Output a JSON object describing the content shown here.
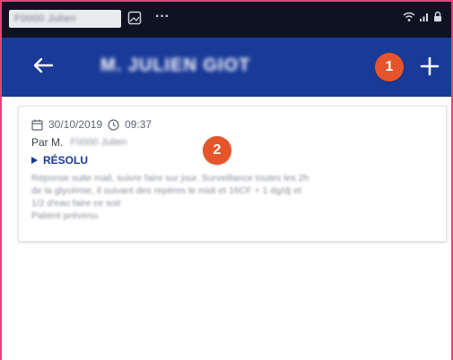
{
  "status_bar": {
    "notification_text": "F0000 Julien",
    "more": "···",
    "icons": [
      "gallery-icon",
      "wifi-icon",
      "signal-icon",
      "lock-icon"
    ]
  },
  "app_bar": {
    "back_icon": "arrow-left-icon",
    "title": "M. JULIEN GIOT",
    "add_icon": "plus-icon"
  },
  "badges": [
    "1",
    "2"
  ],
  "card": {
    "date": "30/10/2019",
    "time": "09:37",
    "author_prefix": "Par M.",
    "author_name": "F0000 Julien",
    "status": "RÉSOLU",
    "note_lines": [
      "Réponse suite mail, suivre faire sur jour. Surveillance toutes les 2h",
      "de la glycémie, il suivant des repères le midi et 16CF + 1 dg/dj et",
      "1/2 d'eau faire ce soir",
      "Patient prévenu."
    ]
  },
  "colors": {
    "app_bar": "#1a3a98",
    "status_bar": "#0d1320",
    "badge": "#e5542a",
    "status_text": "#1a3a98",
    "frame": "#e0457b"
  }
}
